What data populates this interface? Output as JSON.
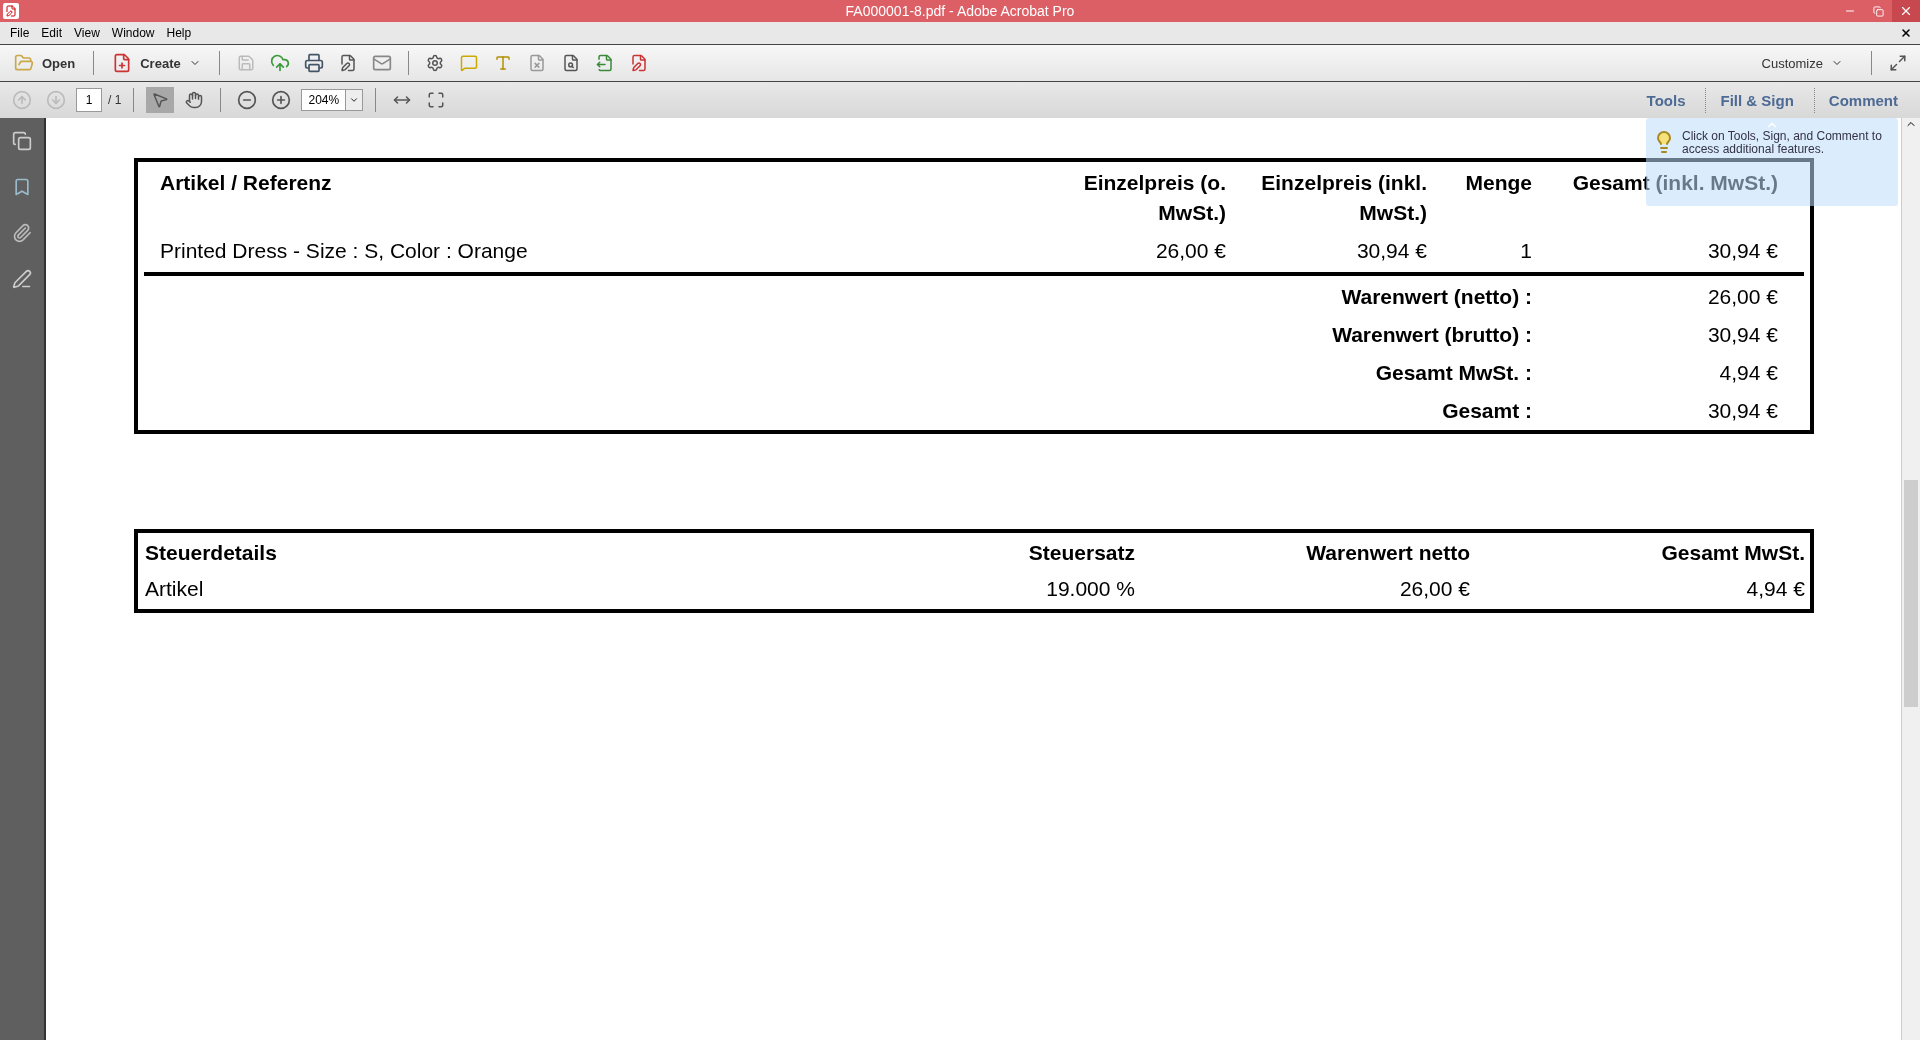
{
  "window": {
    "title": "FA000001-8.pdf - Adobe Acrobat Pro"
  },
  "menu": [
    "File",
    "Edit",
    "View",
    "Window",
    "Help"
  ],
  "toolbar": {
    "open": "Open",
    "create": "Create",
    "customize": "Customize"
  },
  "navigation": {
    "page": "1",
    "page_count": "/ 1",
    "zoom": "204%"
  },
  "panel_tabs": [
    "Tools",
    "Fill & Sign",
    "Comment"
  ],
  "tooltip": {
    "text": "Click on Tools, Sign, and Comment to access additional features."
  },
  "items_table": {
    "columns": [
      "Artikel / Referenz",
      "Einzelpreis (o. MwSt.)",
      "Einzelpreis (inkl. MwSt.)",
      "Menge",
      "Gesamt (inkl. MwSt.)"
    ],
    "rows": [
      [
        "Printed Dress - Size : S, Color : Orange",
        "26,00 €",
        "30,94 €",
        "1",
        "30,94 €"
      ]
    ],
    "totals": [
      {
        "label": "Warenwert (netto) :",
        "value": "26,00 €"
      },
      {
        "label": "Warenwert (brutto) :",
        "value": "30,94 €"
      },
      {
        "label": "Gesamt MwSt. :",
        "value": "4,94 €"
      },
      {
        "label": "Gesamt :",
        "value": "30,94 €"
      }
    ]
  },
  "tax_table": {
    "columns": [
      "Steuerdetails",
      "Steuersatz",
      "Warenwert netto",
      "Gesamt MwSt."
    ],
    "rows": [
      [
        "Artikel",
        "19.000 %",
        "26,00 €",
        "4,94 €"
      ]
    ]
  }
}
